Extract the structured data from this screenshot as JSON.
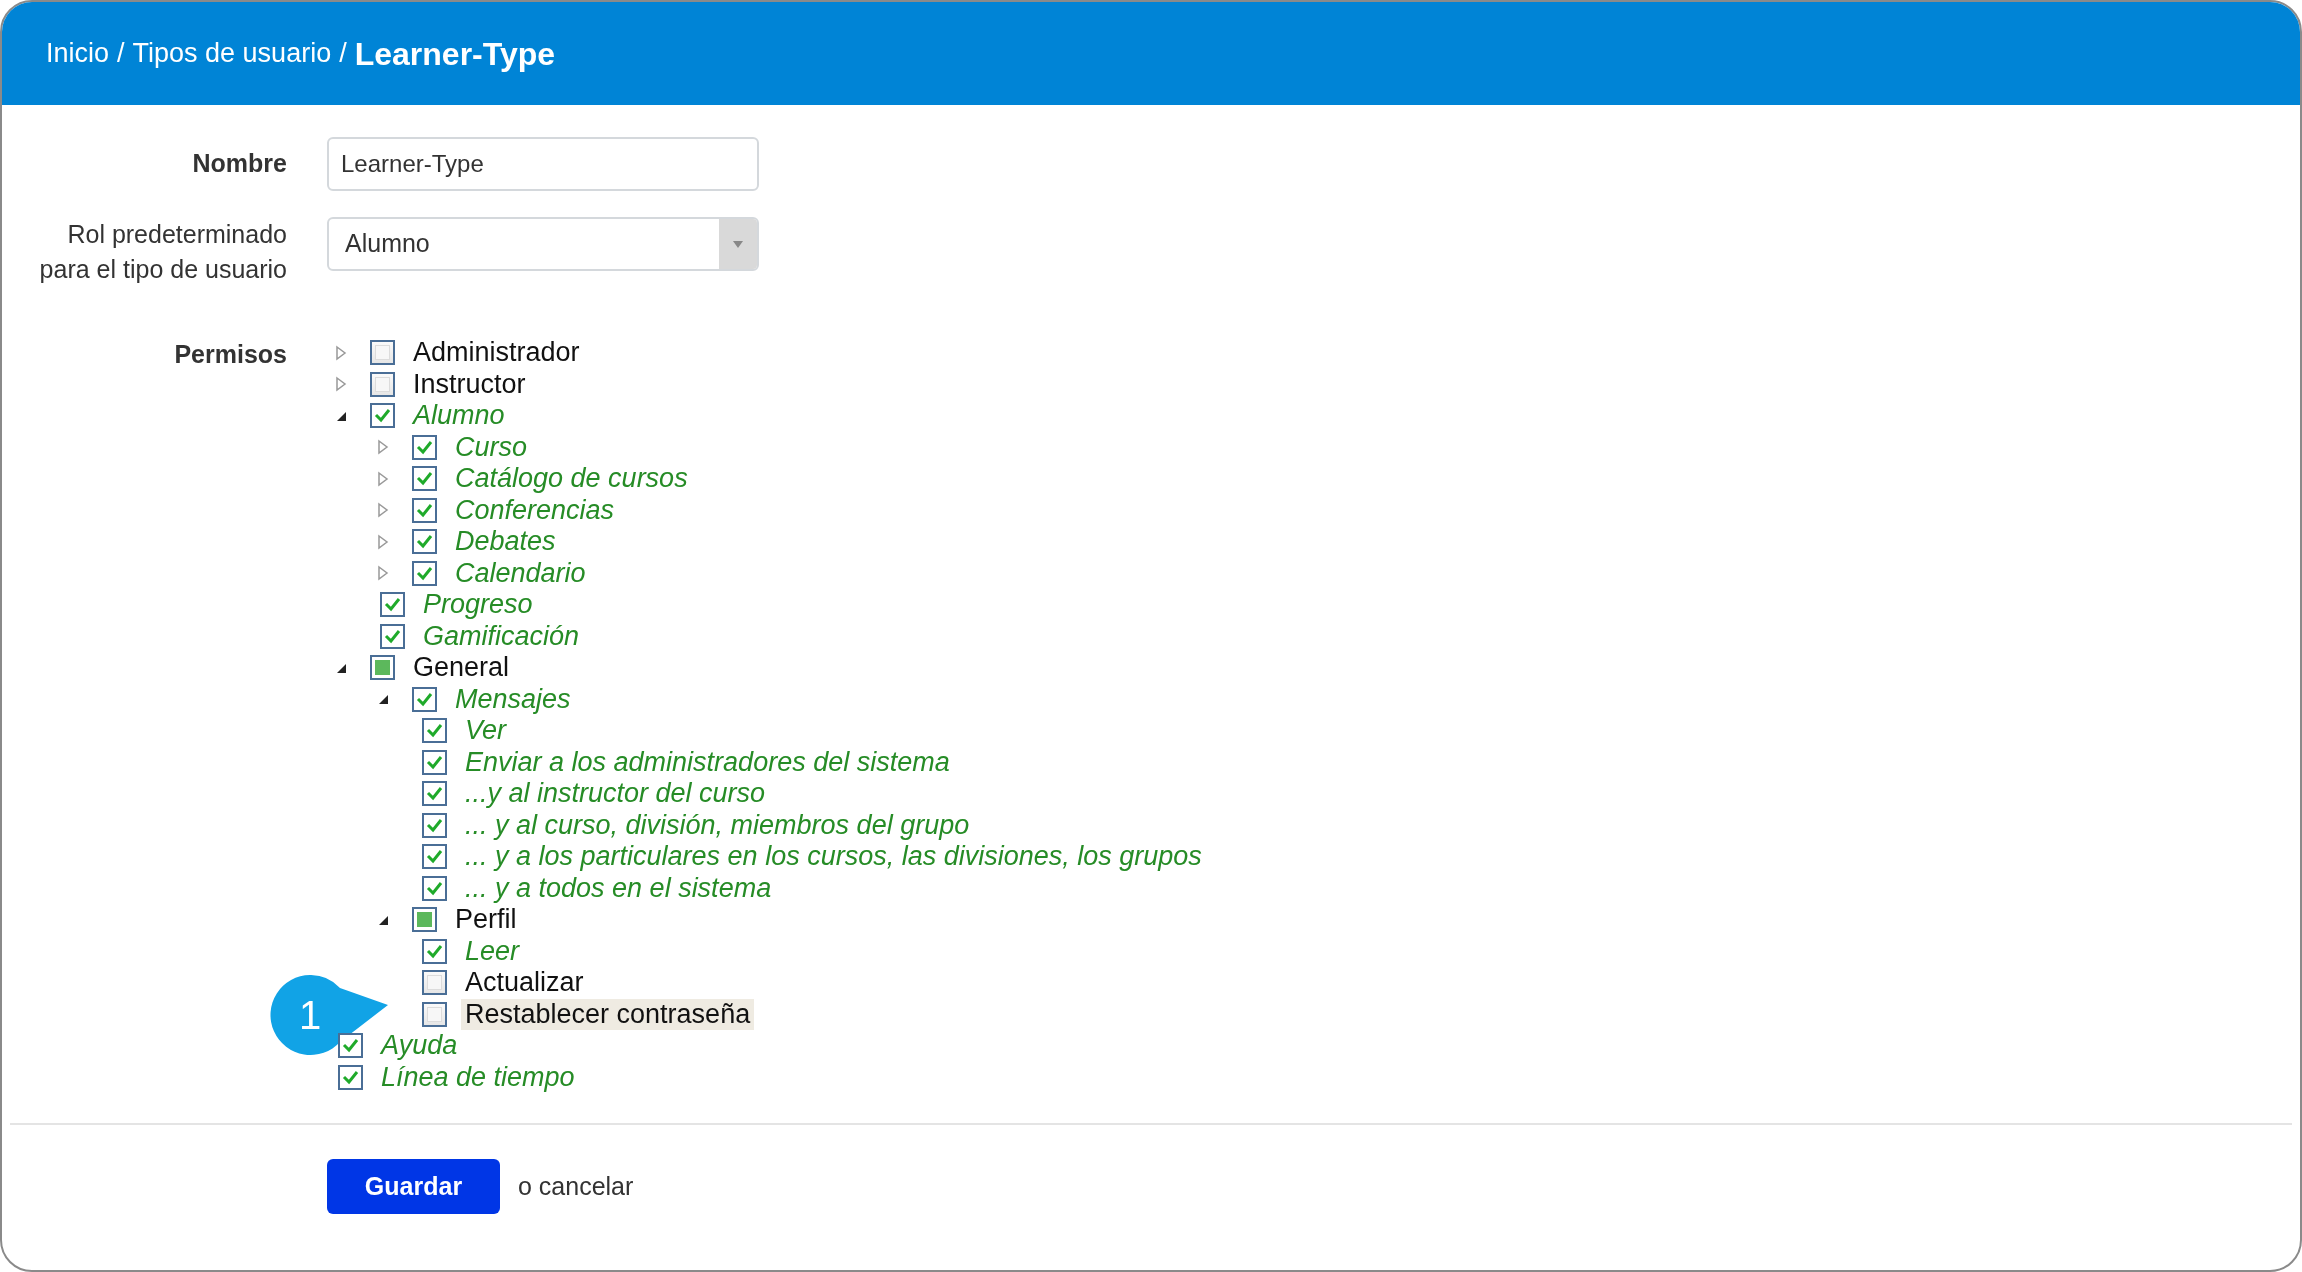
{
  "breadcrumb": {
    "separator": "/",
    "items": [
      {
        "label": "Inicio",
        "kind": "link"
      },
      {
        "label": "Tipos de usuario",
        "kind": "link"
      },
      {
        "label": "Learner-Type",
        "kind": "current"
      }
    ]
  },
  "name_field": {
    "label": "Nombre",
    "value": "Learner-Type"
  },
  "role_field": {
    "label": "Rol predeterminado para el tipo de usuario",
    "value": "Alumno"
  },
  "permissions": {
    "label": "Permisos",
    "tree": [
      {
        "label": "Administrador",
        "checked": false,
        "partial": false,
        "expanded": false,
        "highlighted": false
      },
      {
        "label": "Instructor",
        "checked": false,
        "partial": false,
        "expanded": false,
        "highlighted": false
      },
      {
        "label": "Alumno",
        "checked": true,
        "partial": false,
        "expanded": true,
        "highlighted": false,
        "children": [
          {
            "label": "Curso",
            "checked": true,
            "partial": false,
            "expanded": false,
            "highlighted": false
          },
          {
            "label": "Catálogo de cursos",
            "checked": true,
            "partial": false,
            "expanded": false,
            "highlighted": false
          },
          {
            "label": "Conferencias",
            "checked": true,
            "partial": false,
            "expanded": false,
            "highlighted": false
          },
          {
            "label": "Debates",
            "checked": true,
            "partial": false,
            "expanded": false,
            "highlighted": false
          },
          {
            "label": "Calendario",
            "checked": true,
            "partial": false,
            "expanded": false,
            "highlighted": false
          },
          {
            "label": "Progreso",
            "checked": true,
            "partial": false,
            "highlighted": false
          },
          {
            "label": "Gamificación",
            "checked": true,
            "partial": false,
            "highlighted": false
          }
        ]
      },
      {
        "label": "General",
        "checked": false,
        "partial": true,
        "expanded": true,
        "highlighted": false,
        "children": [
          {
            "label": "Mensajes",
            "checked": true,
            "partial": false,
            "expanded": true,
            "highlighted": false,
            "children": [
              {
                "label": "Ver",
                "checked": true,
                "partial": false,
                "highlighted": false
              },
              {
                "label": "Enviar a los administradores del sistema",
                "checked": true,
                "partial": false,
                "highlighted": false
              },
              {
                "label": "...y al instructor del curso",
                "checked": true,
                "partial": false,
                "highlighted": false
              },
              {
                "label": "... y al curso, división, miembros del grupo",
                "checked": true,
                "partial": false,
                "highlighted": false
              },
              {
                "label": "... y a los particulares en los cursos, las divisiones, los grupos",
                "checked": true,
                "partial": false,
                "highlighted": false
              },
              {
                "label": "... y a todos en el sistema",
                "checked": true,
                "partial": false,
                "highlighted": false
              }
            ]
          },
          {
            "label": "Perfil",
            "checked": false,
            "partial": true,
            "expanded": true,
            "highlighted": false,
            "children": [
              {
                "label": "Leer",
                "checked": true,
                "partial": false,
                "highlighted": false
              },
              {
                "label": "Actualizar",
                "checked": false,
                "partial": false,
                "highlighted": false
              },
              {
                "label": "Restablecer contraseña",
                "checked": false,
                "partial": false,
                "highlighted": true,
                "callout": "1"
              }
            ]
          }
        ]
      },
      {
        "label": "Ayuda",
        "checked": true,
        "partial": false,
        "highlighted": false
      },
      {
        "label": "Línea de tiempo",
        "checked": true,
        "partial": false,
        "highlighted": false
      }
    ]
  },
  "actions": {
    "save": "Guardar",
    "cancel": "o cancelar"
  }
}
